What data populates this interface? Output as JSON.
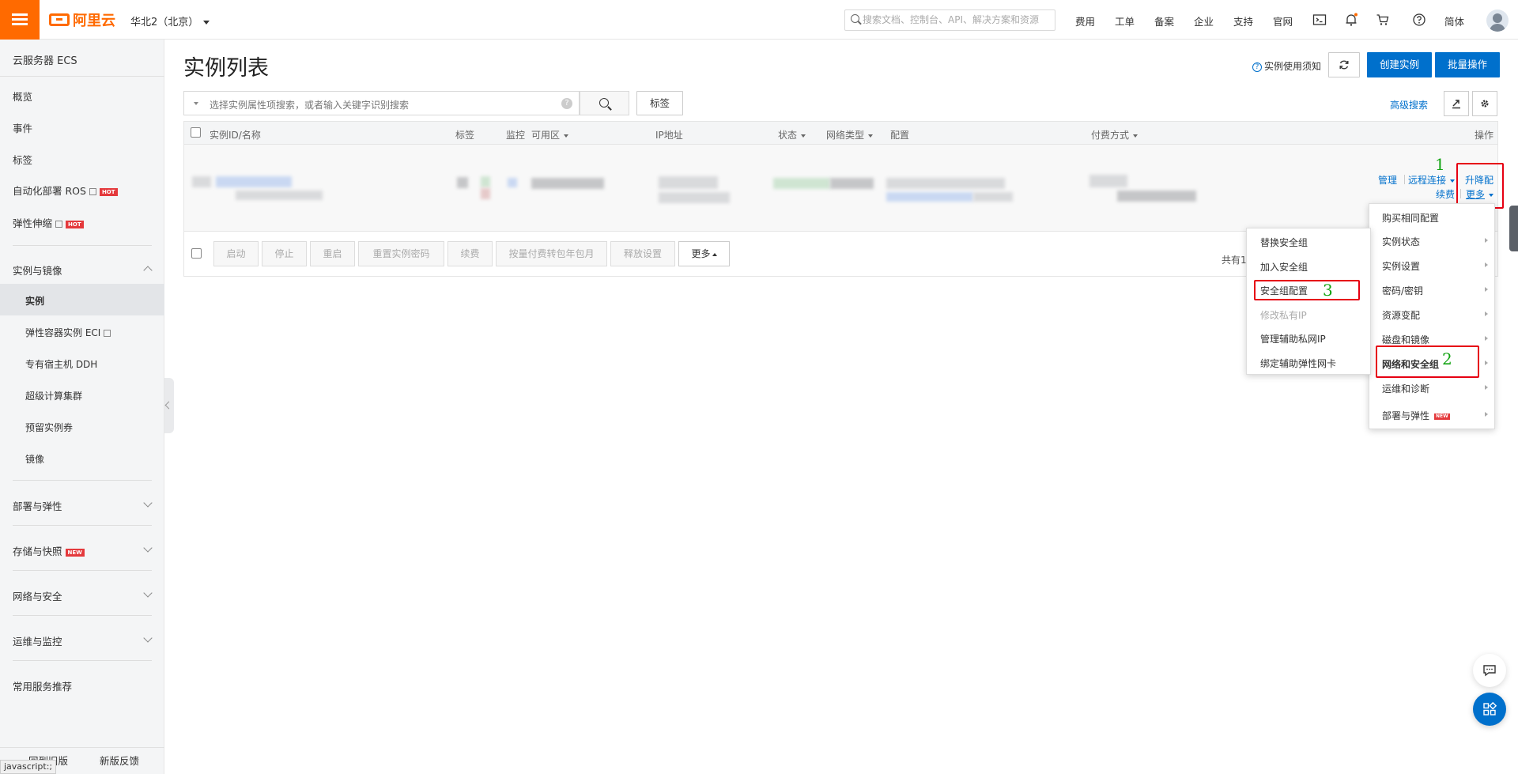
{
  "header": {
    "logo_text": "阿里云",
    "region": "华北2（北京）",
    "search_placeholder": "搜索文档、控制台、API、解决方案和资源",
    "nav": [
      "费用",
      "工单",
      "备案",
      "企业",
      "支持",
      "官网"
    ],
    "lang": "简体"
  },
  "sidebar": {
    "title": "云服务器 ECS",
    "items_top": [
      "概览",
      "事件",
      "标签"
    ],
    "ros": "自动化部署 ROS",
    "scaling": "弹性伸缩",
    "hot": "HOT",
    "group_instances": "实例与镜像",
    "sub": [
      "实例",
      "弹性容器实例 ECI",
      "专有宿主机 DDH",
      "超级计算集群",
      "预留实例券",
      "镜像"
    ],
    "groups": [
      "部署与弹性",
      "存储与快照",
      "网络与安全",
      "运维与监控"
    ],
    "new": "NEW",
    "recommend": "常用服务推荐",
    "bottom_left": "回到旧版",
    "bottom_right": "新版反馈"
  },
  "main": {
    "title": "实例列表",
    "notice": "实例使用须知",
    "create": "创建实例",
    "batch": "批量操作",
    "filter_placeholder": "选择实例属性项搜索，或者输入关键字识别搜索",
    "tag_btn": "标签",
    "advanced_search": "高级搜索",
    "columns": [
      "实例ID/名称",
      "标签",
      "监控",
      "可用区",
      "IP地址",
      "状态",
      "网络类型",
      "配置",
      "付费方式",
      "操作"
    ],
    "row_actions": {
      "manage": "管理",
      "remote": "远程连接",
      "upgrade": "升降配",
      "renew": "续费",
      "more": "更多"
    },
    "footer_buttons": [
      "启动",
      "停止",
      "重启",
      "重置实例密码",
      "续费",
      "按量付费转包年包月",
      "释放设置",
      "更多"
    ],
    "total": "共有1"
  },
  "more_menu": [
    "购买相同配置",
    "实例状态",
    "实例设置",
    "密码/密钥",
    "资源变配",
    "磁盘和镜像",
    "网络和安全组",
    "运维和诊断",
    "部署与弹性"
  ],
  "sub_menu": [
    "替换安全组",
    "加入安全组",
    "安全组配置",
    "修改私有IP",
    "管理辅助私网IP",
    "绑定辅助弹性网卡"
  ],
  "annotations": [
    "1",
    "2",
    "3"
  ],
  "status_text": "javascript:;",
  "colors": {
    "accent": "#ff6a00",
    "primary": "#0070cc",
    "highlight": "#e60012",
    "annotation": "#11a311"
  }
}
